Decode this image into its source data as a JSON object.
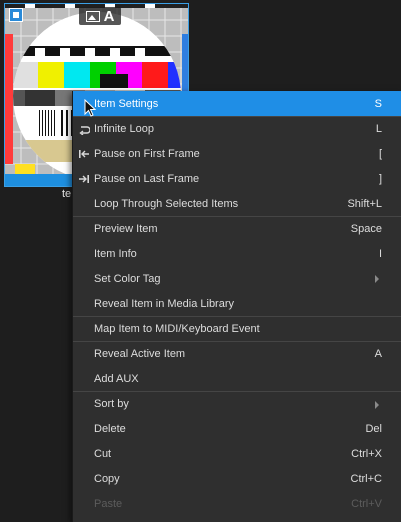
{
  "thumbnail": {
    "badge_letter": "A",
    "badge_icon": "image-icon",
    "caption": "te"
  },
  "menu": {
    "items": [
      {
        "label": "Item Settings",
        "shortcut": "S",
        "icon": "",
        "state": "active"
      },
      {
        "label": "Infinite Loop",
        "shortcut": "L",
        "icon": "loop-icon",
        "state": "normal"
      },
      {
        "label": "Pause on First Frame",
        "shortcut": "[",
        "icon": "pause-first-frame-icon",
        "state": "normal"
      },
      {
        "label": "Pause on Last Frame",
        "shortcut": "]",
        "icon": "pause-last-frame-icon",
        "state": "normal"
      },
      {
        "label": "Loop Through Selected Items",
        "shortcut": "Shift+L",
        "icon": "",
        "state": "normal"
      },
      {
        "label": "Preview Item",
        "shortcut": "Space",
        "icon": "",
        "state": "normal"
      },
      {
        "label": "Item Info",
        "shortcut": "I",
        "icon": "",
        "state": "normal"
      },
      {
        "label": "Set Color Tag",
        "shortcut": "",
        "icon": "",
        "state": "submenu"
      },
      {
        "label": "Reveal Item in Media Library",
        "shortcut": "",
        "icon": "",
        "state": "normal"
      },
      {
        "label": "Map Item to MIDI/Keyboard Event",
        "shortcut": "",
        "icon": "",
        "state": "normal"
      },
      {
        "label": "Reveal Active Item",
        "shortcut": "A",
        "icon": "",
        "state": "normal"
      },
      {
        "label": "Add AUX",
        "shortcut": "",
        "icon": "",
        "state": "normal"
      },
      {
        "label": "Sort by",
        "shortcut": "",
        "icon": "",
        "state": "submenu"
      },
      {
        "label": "Delete",
        "shortcut": "Del",
        "icon": "",
        "state": "normal"
      },
      {
        "label": "Cut",
        "shortcut": "Ctrl+X",
        "icon": "",
        "state": "normal"
      },
      {
        "label": "Copy",
        "shortcut": "Ctrl+C",
        "icon": "",
        "state": "normal"
      },
      {
        "label": "Paste",
        "shortcut": "Ctrl+V",
        "icon": "",
        "state": "disabled"
      }
    ]
  },
  "colors": {
    "accent": "#1f8ee6",
    "menu_bg": "#2f2f2f",
    "window_bg": "#1e1e1e",
    "text": "#dddddd",
    "disabled_text": "#5c5c5c"
  }
}
